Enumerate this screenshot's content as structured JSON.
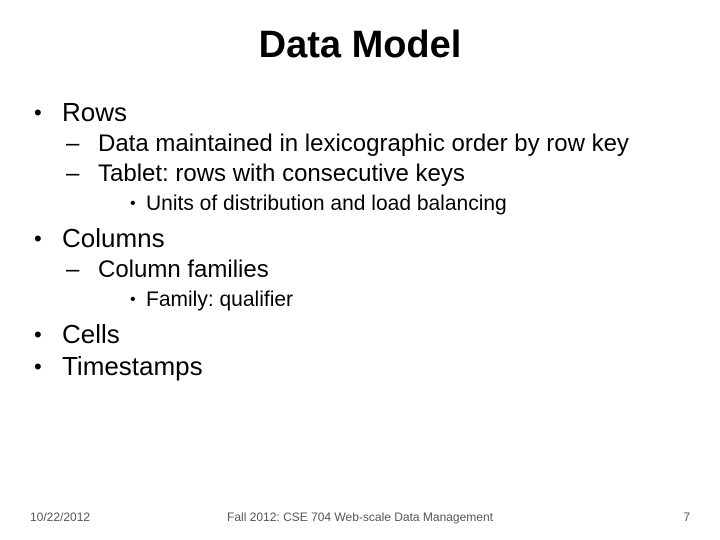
{
  "title": "Data Model",
  "bullets": {
    "rows": "Rows",
    "rows_sub1": "Data maintained in lexicographic order by row key",
    "rows_sub2": "Tablet: rows with consecutive keys",
    "rows_sub2_sub1": "Units of distribution and load balancing",
    "columns": "Columns",
    "columns_sub1": "Column families",
    "columns_sub1_sub1": "Family: qualifier",
    "cells": "Cells",
    "timestamps": "Timestamps"
  },
  "footer": {
    "date": "10/22/2012",
    "center": "Fall 2012: CSE 704 Web-scale Data Management",
    "page": "7"
  }
}
